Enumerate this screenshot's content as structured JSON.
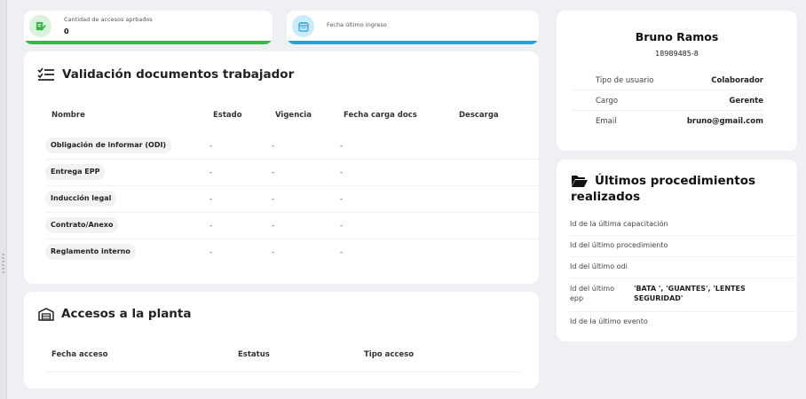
{
  "stats": {
    "approved": {
      "label": "Cantidad de accesos aprbados",
      "value": "0",
      "color": "#3ab54a"
    },
    "last_login": {
      "label": "Fecha último ingreso",
      "value": "",
      "color": "#2a9fd0"
    }
  },
  "documents": {
    "title": "Validación documentos trabajador",
    "columns": [
      "Nombre",
      "Estado",
      "Vigencia",
      "Fecha carga docs",
      "Descarga"
    ],
    "rows": [
      {
        "name": "Obligación de informar (ODI)",
        "estado": "-",
        "vigencia": "-",
        "fecha": "-",
        "descarga": ""
      },
      {
        "name": "Entrega EPP",
        "estado": "-",
        "vigencia": "-",
        "fecha": "-",
        "descarga": ""
      },
      {
        "name": "Inducción legal",
        "estado": "-",
        "vigencia": "-",
        "fecha": "-",
        "descarga": ""
      },
      {
        "name": "Contrato/Anexo",
        "estado": "-",
        "vigencia": "-",
        "fecha": "-",
        "descarga": ""
      },
      {
        "name": "Reglamento interno",
        "estado": "-",
        "vigencia": "-",
        "fecha": "-",
        "descarga": ""
      }
    ]
  },
  "access": {
    "title": "Accesos a la planta",
    "columns": [
      "Fecha acceso",
      "Estatus",
      "Tipo acceso"
    ]
  },
  "profile": {
    "name": "Bruno Ramos",
    "rut": "18989485-8",
    "fields": [
      {
        "label": "Tipo de usuario",
        "value": "Colaborador"
      },
      {
        "label": "Cargo",
        "value": "Gerente"
      },
      {
        "label": "Email",
        "value": "bruno@gmail.com"
      }
    ]
  },
  "procedures": {
    "title": "Últimos procedimientos realizados",
    "rows": [
      {
        "label": "Id de la última capacitación",
        "value": ""
      },
      {
        "label": "Id del último procedimiento",
        "value": ""
      },
      {
        "label": "Id del último odi",
        "value": ""
      },
      {
        "label": "Id del último epp",
        "value": "'BATA ', 'GUANTES', 'LENTES SEGURIDAD'"
      },
      {
        "label": "Id de la último evento",
        "value": ""
      }
    ]
  }
}
